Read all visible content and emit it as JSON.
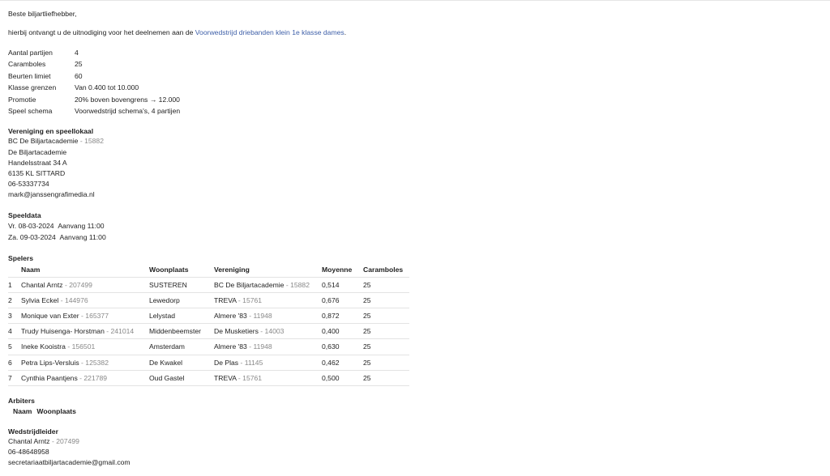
{
  "greeting": "Beste biljartliefhebber,",
  "intro": {
    "before": "hierbij ontvangt u de uitnodiging voor het deelnemen aan de ",
    "link": "Voorwedstrijd driebanden klein 1e klasse dames",
    "after": "."
  },
  "params": [
    {
      "label": "Aantal partijen",
      "value": "4"
    },
    {
      "label": "Caramboles",
      "value": "25"
    },
    {
      "label": "Beurten limiet",
      "value": "60"
    },
    {
      "label": "Klasse grenzen",
      "value": "Van 0.400 tot 10.000"
    },
    {
      "label": "Promotie",
      "value": "20% boven bovengrens → 12.000"
    },
    {
      "label": "Speel schema",
      "value": "Voorwedstrijd schema's, 4 partijen"
    }
  ],
  "venue": {
    "heading": "Vereniging en speellokaal",
    "club": "BC De Biljartacademie",
    "club_id": " - 15882",
    "lines": [
      "De Biljartacademie",
      "Handelsstraat 34 A",
      "6135 KL SITTARD",
      "06-53337734",
      "mark@janssengrafimedia.nl"
    ]
  },
  "dates": {
    "heading": "Speeldata",
    "items": [
      {
        "day": "Vr. 08-03-2024",
        "start": "Aanvang 11:00"
      },
      {
        "day": "Za. 09-03-2024",
        "start": "Aanvang 11:00"
      }
    ]
  },
  "players": {
    "heading": "Spelers",
    "columns": [
      "",
      "Naam",
      "Woonplaats",
      "Vereniging",
      "Moyenne",
      "Caramboles"
    ],
    "rows": [
      {
        "nr": "1",
        "name": "Chantal Arntz",
        "id": " - 207499",
        "city": "SUSTEREN",
        "club": "BC De Biljartacademie",
        "club_id": " - 15882",
        "moy": "0,514",
        "car": "25"
      },
      {
        "nr": "2",
        "name": "Sylvia Eckel",
        "id": " - 144976",
        "city": "Lewedorp",
        "club": "TREVA",
        "club_id": " - 15761",
        "moy": "0,676",
        "car": "25"
      },
      {
        "nr": "3",
        "name": "Monique van Exter",
        "id": " - 165377",
        "city": "Lelystad",
        "club": "Almere '83",
        "club_id": " - 11948",
        "moy": "0,872",
        "car": "25"
      },
      {
        "nr": "4",
        "name": "Trudy Huisenga- Horstman",
        "id": " - 241014",
        "city": "Middenbeemster",
        "club": "De Musketiers",
        "club_id": " - 14003",
        "moy": "0,400",
        "car": "25"
      },
      {
        "nr": "5",
        "name": "Ineke Kooistra",
        "id": " - 156501",
        "city": "Amsterdam",
        "club": "Almere '83",
        "club_id": " - 11948",
        "moy": "0,630",
        "car": "25"
      },
      {
        "nr": "6",
        "name": "Petra Lips-Versluis",
        "id": " - 125382",
        "city": "De Kwakel",
        "club": "De Plas",
        "club_id": " - 11145",
        "moy": "0,462",
        "car": "25"
      },
      {
        "nr": "7",
        "name": "Cynthia Paantjens",
        "id": " - 221789",
        "city": "Oud Gastel",
        "club": "TREVA",
        "club_id": " - 15761",
        "moy": "0,500",
        "car": "25"
      }
    ]
  },
  "referees": {
    "heading": "Arbiters",
    "columns": [
      "Naam",
      "Woonplaats"
    ]
  },
  "leader": {
    "heading": "Wedstrijdleider",
    "name": "Chantal Arntz",
    "id": " - 207499",
    "phone": "06-48648958",
    "email": "secretariaatbiljartacademie@gmail.com"
  }
}
